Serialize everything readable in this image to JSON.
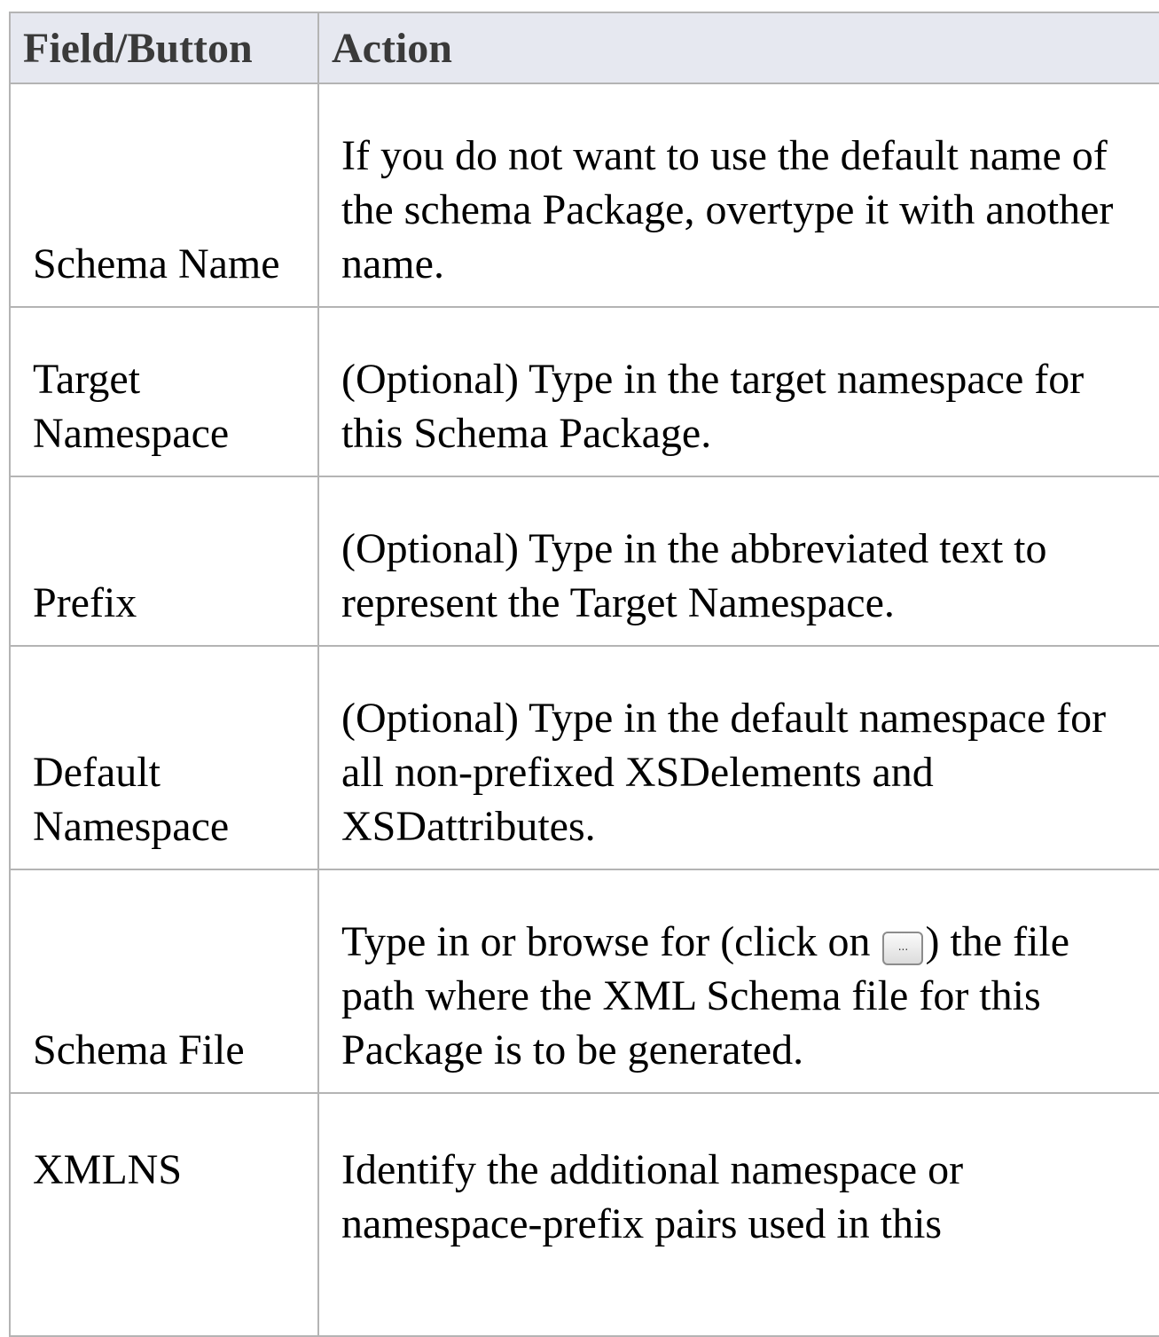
{
  "table": {
    "headers": {
      "field": "Field/Button",
      "action": "Action"
    },
    "rows": [
      {
        "field": "Schema Name",
        "action": "If you do not want to use the default name of the schema Package, overtype it with another name."
      },
      {
        "field": "Target Namespace",
        "action": "(Optional) Type in the target namespace for this Schema Package."
      },
      {
        "field": "Prefix",
        "action": "(Optional) Type in the abbreviated text to represent the Target Namespace."
      },
      {
        "field": "Default Namespace",
        "action": "(Optional) Type in the default namespace for all non-prefixed XSDelements and XSDattributes."
      },
      {
        "field": "Schema File",
        "action_before": "Type in or browse for (click on ",
        "browse_button_glyph": "...",
        "action_after": ") the file path where the XML Schema file for this Package is to be generated."
      },
      {
        "field": "XMLNS",
        "action": "Identify the additional namespace or namespace-prefix pairs used in this"
      }
    ]
  },
  "icons": {
    "browse_button": "ellipsis-browse-icon"
  }
}
